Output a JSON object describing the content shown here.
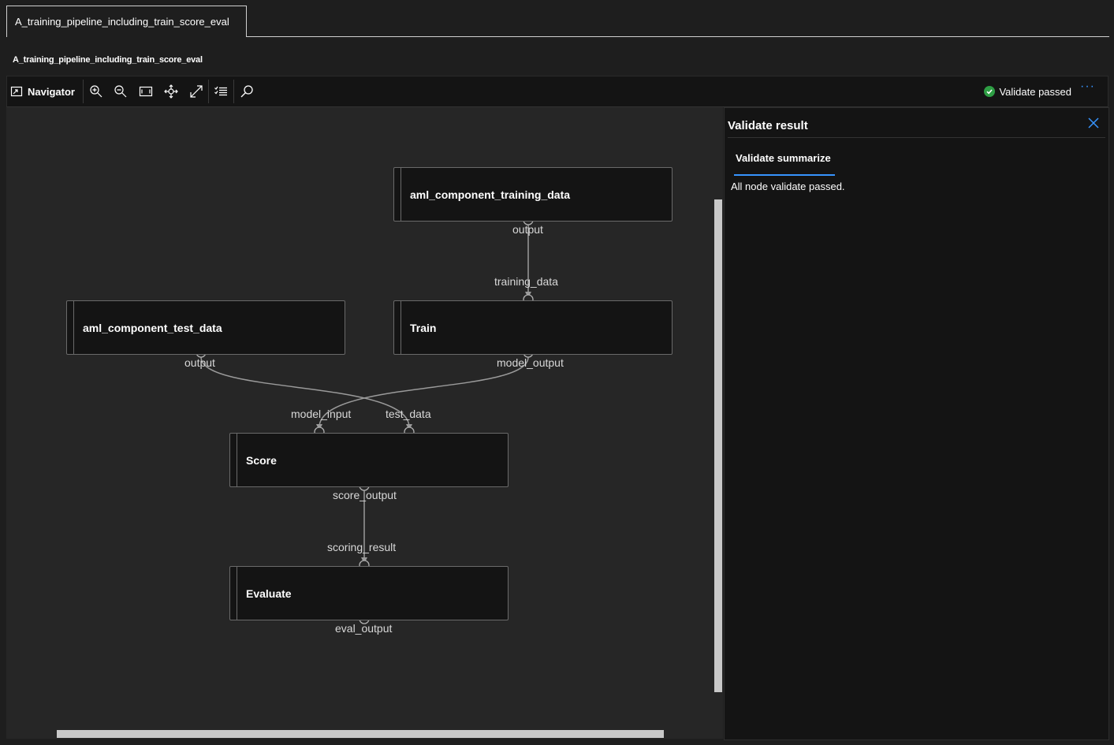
{
  "tab": {
    "label": "A_training_pipeline_including_train_score_eval"
  },
  "pipeline": {
    "title": "A_training_pipeline_including_train_score_eval"
  },
  "toolbar": {
    "navigator_label": "Navigator",
    "validate_status": "Validate passed",
    "more_label": "···",
    "icons": [
      "navigator-icon",
      "zoom-in-icon",
      "zoom-out-icon",
      "fit-to-screen-icon",
      "pan-icon",
      "fullscreen-icon",
      "list-icon",
      "search-icon",
      "check-circle-icon",
      "more-icon"
    ],
    "status_color": "#2e9e44"
  },
  "graph": {
    "nodes": {
      "training_data": {
        "title": "aml_component_training_data",
        "output": "output"
      },
      "test_data": {
        "title": "aml_component_test_data",
        "output": "output"
      },
      "train": {
        "title": "Train",
        "input": "training_data",
        "output": "model_output"
      },
      "score": {
        "title": "Score",
        "input_model": "model_input",
        "input_test": "test_data",
        "output": "score_output"
      },
      "evaluate": {
        "title": "Evaluate",
        "input": "scoring_result",
        "output": "eval_output"
      }
    }
  },
  "panel": {
    "title": "Validate result",
    "tab": "Validate summarize",
    "message": "All node validate passed.",
    "accent": "#3794ff"
  }
}
